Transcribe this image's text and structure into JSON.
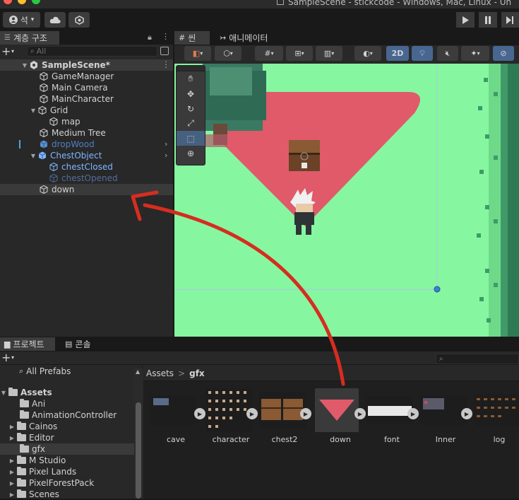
{
  "window": {
    "title": "SampleScene - stickcode - Windows, Mac, Linux - Un"
  },
  "toolbar": {
    "account_label": "석",
    "account_caret": "▾"
  },
  "hierarchy": {
    "tab_label": "계층 구조",
    "search_placeholder": "All",
    "scene_name": "SampleScene*",
    "items": [
      {
        "label": "GameManager"
      },
      {
        "label": "Main Camera"
      },
      {
        "label": "MainCharacter"
      },
      {
        "label": "Grid"
      },
      {
        "label": "map"
      },
      {
        "label": "Medium Tree"
      },
      {
        "label": "dropWood"
      },
      {
        "label": "ChestObject"
      },
      {
        "label": "chestClosed"
      },
      {
        "label": "chestOpened"
      },
      {
        "label": "down"
      }
    ]
  },
  "scene": {
    "tabs": [
      {
        "label": "씬"
      },
      {
        "label": "애니메이터"
      }
    ],
    "mode_2d": "2D"
  },
  "bottom": {
    "tabs": [
      {
        "label": "프로젝트"
      },
      {
        "label": "콘솔"
      }
    ],
    "all_prefabs": "All Prefabs",
    "tree": [
      {
        "label": "Assets"
      },
      {
        "label": "Ani"
      },
      {
        "label": "AnimationController"
      },
      {
        "label": "Cainos"
      },
      {
        "label": "Editor"
      },
      {
        "label": "gfx"
      },
      {
        "label": "M Studio"
      },
      {
        "label": "Pixel Lands"
      },
      {
        "label": "PixelForestPack"
      },
      {
        "label": "Scenes"
      }
    ],
    "breadcrumb": {
      "root": "Assets",
      "sep": ">",
      "current": "gfx"
    },
    "assets": [
      {
        "label": "cave"
      },
      {
        "label": "character"
      },
      {
        "label": "chest2"
      },
      {
        "label": "down"
      },
      {
        "label": "font"
      },
      {
        "label": "Inner"
      },
      {
        "label": "log"
      }
    ]
  },
  "colors": {
    "scene_green": "#86f7a0",
    "triangle_red": "#e05a6a",
    "arrow_red": "#d62d20",
    "accent_blue": "#4fa3e0",
    "prefab_blue": "#7fb6ff"
  }
}
